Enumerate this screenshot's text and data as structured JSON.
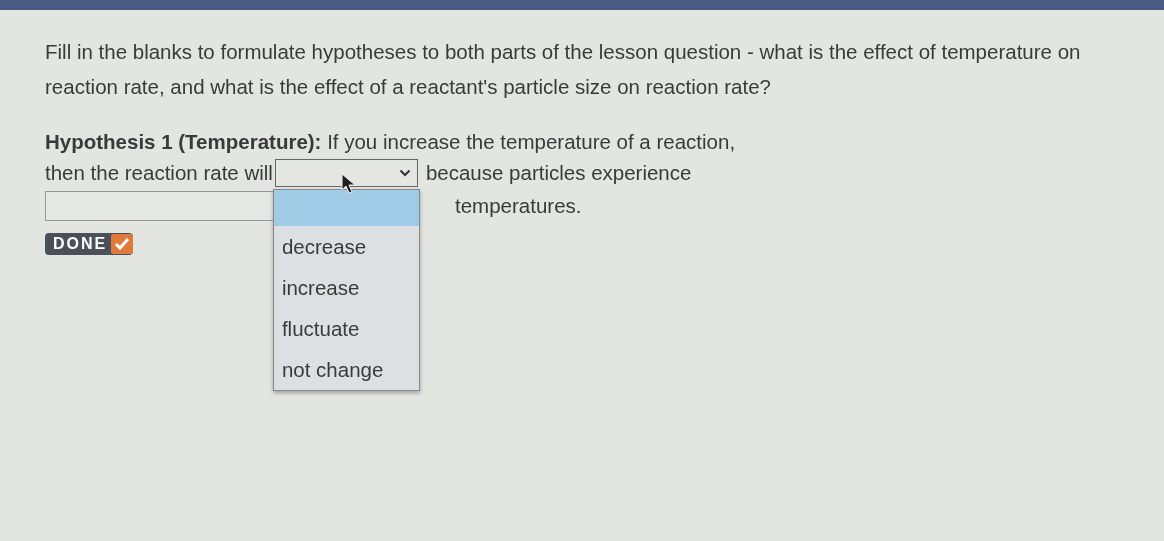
{
  "question": "Fill in the blanks to formulate hypotheses to both parts of the lesson question - what is the effect of temperature on reaction rate, and what is the effect of a reactant's particle size on reaction rate?",
  "hypothesis": {
    "intro": "**Hypothesis 1 (Temperature):** If you increase the temperature of a reaction,",
    "before_dropdown": "then the reaction rate will",
    "dropdown": {
      "expanded": true,
      "blank_option_highlighted": true,
      "options": [
        {
          "label": "decrease",
          "selected": false
        },
        {
          "label": "increase",
          "selected": false
        },
        {
          "label": "fluctuate",
          "selected": false
        },
        {
          "label": "not change",
          "selected": false
        }
      ]
    },
    "after_dropdown": "because particles experience",
    "ending": "temperatures."
  },
  "done_button": {
    "label": "DONE"
  }
}
